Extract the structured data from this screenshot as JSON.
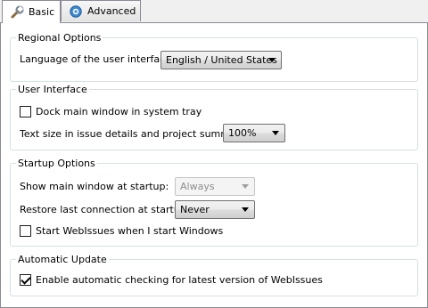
{
  "tabs": [
    {
      "label": "Basic",
      "icon": "wrench-icon"
    },
    {
      "label": "Advanced",
      "icon": "gear-icon"
    }
  ],
  "regional": {
    "title": "Regional Options",
    "language_label": "Language of the user interface:",
    "language_value": "English / United States"
  },
  "ui": {
    "title": "User Interface",
    "dock_label": "Dock main window in system tray",
    "dock_checked": false,
    "text_size_label": "Text size in issue details and project summary:",
    "text_size_value": "100%"
  },
  "startup": {
    "title": "Startup Options",
    "show_label": "Show main window at startup:",
    "show_value": "Always",
    "restore_label": "Restore last connection at startup:",
    "restore_value": "Never",
    "autostart_label": "Start WebIssues when I start Windows",
    "autostart_checked": false
  },
  "update": {
    "title": "Automatic Update",
    "check_label": "Enable automatic checking for latest version of WebIssues",
    "check_checked": true
  }
}
